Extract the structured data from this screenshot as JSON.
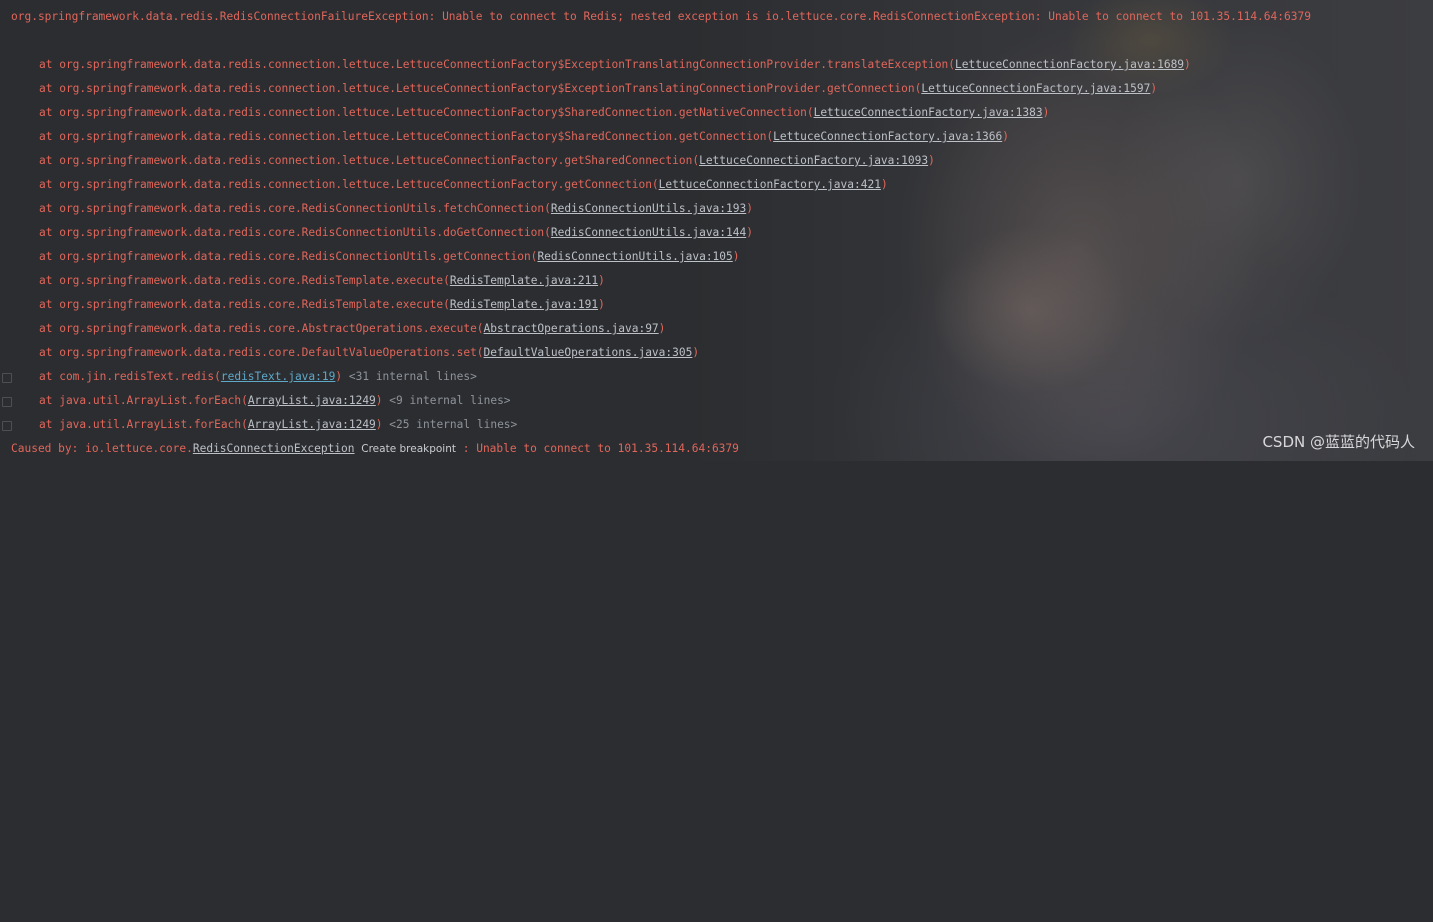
{
  "console": {
    "exception_header": "org.springframework.data.redis.RedisConnectionFailureException: Unable to connect to Redis; nested exception is io.lettuce.core.RedisConnectionException: Unable to connect to 101.35.114.64:6379",
    "frames": [
      {
        "method": "at org.springframework.data.redis.connection.lettuce.LettuceConnectionFactory$ExceptionTranslatingConnectionProvider.translateException(",
        "link": "LettuceConnectionFactory.java:1689",
        "close": ")",
        "internal": ""
      },
      {
        "method": "at org.springframework.data.redis.connection.lettuce.LettuceConnectionFactory$ExceptionTranslatingConnectionProvider.getConnection(",
        "link": "LettuceConnectionFactory.java:1597",
        "close": ")",
        "internal": ""
      },
      {
        "method": "at org.springframework.data.redis.connection.lettuce.LettuceConnectionFactory$SharedConnection.getNativeConnection(",
        "link": "LettuceConnectionFactory.java:1383",
        "close": ")",
        "internal": ""
      },
      {
        "method": "at org.springframework.data.redis.connection.lettuce.LettuceConnectionFactory$SharedConnection.getConnection(",
        "link": "LettuceConnectionFactory.java:1366",
        "close": ")",
        "internal": ""
      },
      {
        "method": "at org.springframework.data.redis.connection.lettuce.LettuceConnectionFactory.getSharedConnection(",
        "link": "LettuceConnectionFactory.java:1093",
        "close": ")",
        "internal": ""
      },
      {
        "method": "at org.springframework.data.redis.connection.lettuce.LettuceConnectionFactory.getConnection(",
        "link": "LettuceConnectionFactory.java:421",
        "close": ")",
        "internal": ""
      },
      {
        "method": "at org.springframework.data.redis.core.RedisConnectionUtils.fetchConnection(",
        "link": "RedisConnectionUtils.java:193",
        "close": ")",
        "internal": ""
      },
      {
        "method": "at org.springframework.data.redis.core.RedisConnectionUtils.doGetConnection(",
        "link": "RedisConnectionUtils.java:144",
        "close": ")",
        "internal": ""
      },
      {
        "method": "at org.springframework.data.redis.core.RedisConnectionUtils.getConnection(",
        "link": "RedisConnectionUtils.java:105",
        "close": ")",
        "internal": ""
      },
      {
        "method": "at org.springframework.data.redis.core.RedisTemplate.execute(",
        "link": "RedisTemplate.java:211",
        "close": ")",
        "internal": ""
      },
      {
        "method": "at org.springframework.data.redis.core.RedisTemplate.execute(",
        "link": "RedisTemplate.java:191",
        "close": ")",
        "internal": ""
      },
      {
        "method": "at org.springframework.data.redis.core.AbstractOperations.execute(",
        "link": "AbstractOperations.java:97",
        "close": ")",
        "internal": ""
      },
      {
        "method": "at org.springframework.data.redis.core.DefaultValueOperations.set(",
        "link": "DefaultValueOperations.java:305",
        "close": ")",
        "internal": ""
      },
      {
        "method": "at com.jin.redisText.redis(",
        "link": "redisText.java:19",
        "close": ")",
        "internal": "<31 internal lines>"
      },
      {
        "method": "at java.util.ArrayList.forEach(",
        "link": "ArrayList.java:1249",
        "close": ")",
        "internal": "<9 internal lines>"
      },
      {
        "method": "at java.util.ArrayList.forEach(",
        "link": "ArrayList.java:1249",
        "close": ")",
        "internal": "<25 internal lines>"
      }
    ],
    "caused_by": {
      "prefix": "Caused by: io.lettuce.core.",
      "link": "RedisConnectionException",
      "breakpoint_label": "Create breakpoint",
      "suffix": " : Unable to connect to 101.35.114.64:6379"
    }
  },
  "watermark": "CSDN @蓝蓝的代码人",
  "colors": {
    "error_text": "#e0665b",
    "link_text": "#bcc0c7",
    "user_link": "#5fa8c8",
    "muted_text": "#8f939a",
    "background": "#2b2d30"
  }
}
